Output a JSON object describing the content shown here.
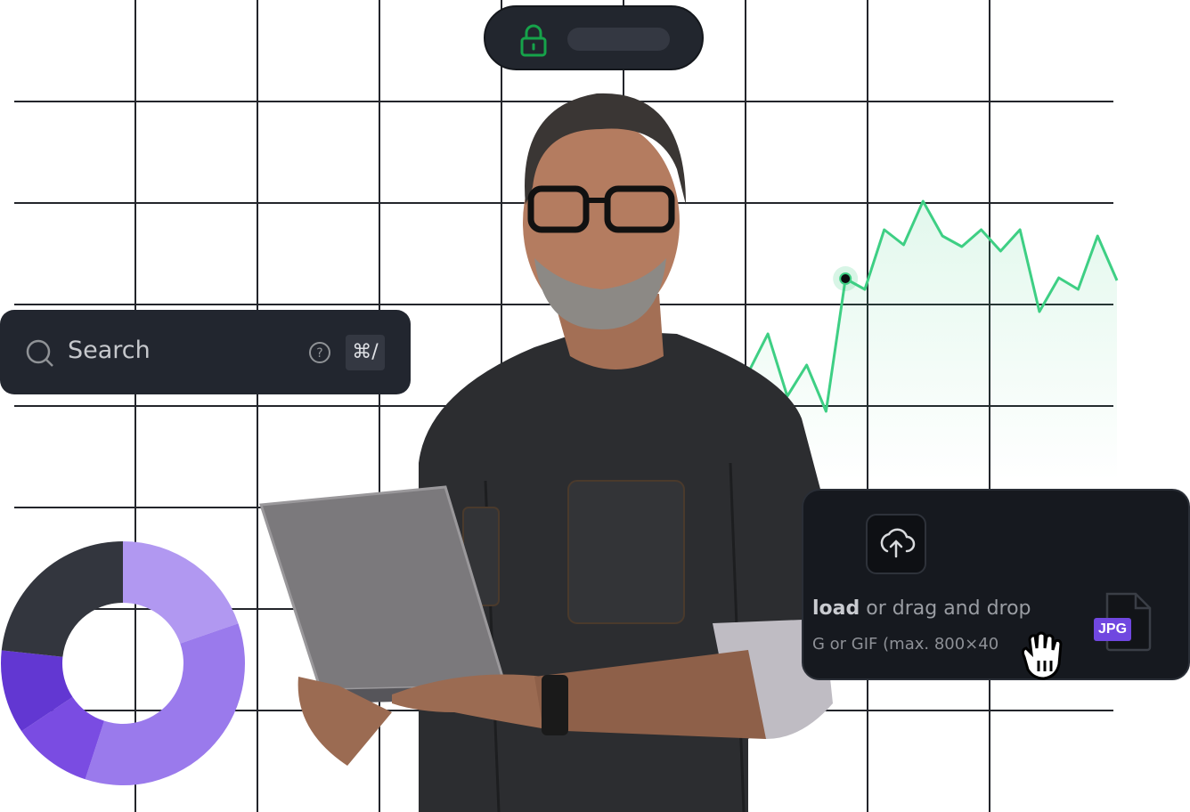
{
  "lock_pill": {
    "icon": "lock-icon",
    "accent": "#16a34a"
  },
  "search": {
    "placeholder": "Search",
    "shortcut": "⌘/",
    "icons": [
      "search-icon",
      "help-circle-icon"
    ]
  },
  "upload": {
    "icon": "cloud-upload-icon",
    "action_bold": "load",
    "action_text": " or drag and drop",
    "hint": "G or GIF (max. 800×40",
    "hint_tail": ")",
    "file_badge": "JPG",
    "badge_color": "#7047e0"
  },
  "cursor": "grab-hand-icon",
  "line_chart": {
    "color": "#3ecf84",
    "values": [
      527,
      497,
      504,
      494,
      537,
      467,
      502,
      450,
      599,
      587,
      654,
      637,
      686,
      647,
      635,
      654,
      630,
      654,
      562,
      600,
      587,
      647,
      597
    ],
    "highlight_index": 8
  },
  "donut": {
    "segments": [
      {
        "share": 0.197,
        "color": "#b198f1"
      },
      {
        "share": 0.353,
        "color": "#9a7aec"
      },
      {
        "share": 0.106,
        "color": "#7a4ce2"
      },
      {
        "share": 0.111,
        "color": "#6237d2"
      },
      {
        "share": 0.233,
        "color": "#33363e"
      }
    ]
  }
}
